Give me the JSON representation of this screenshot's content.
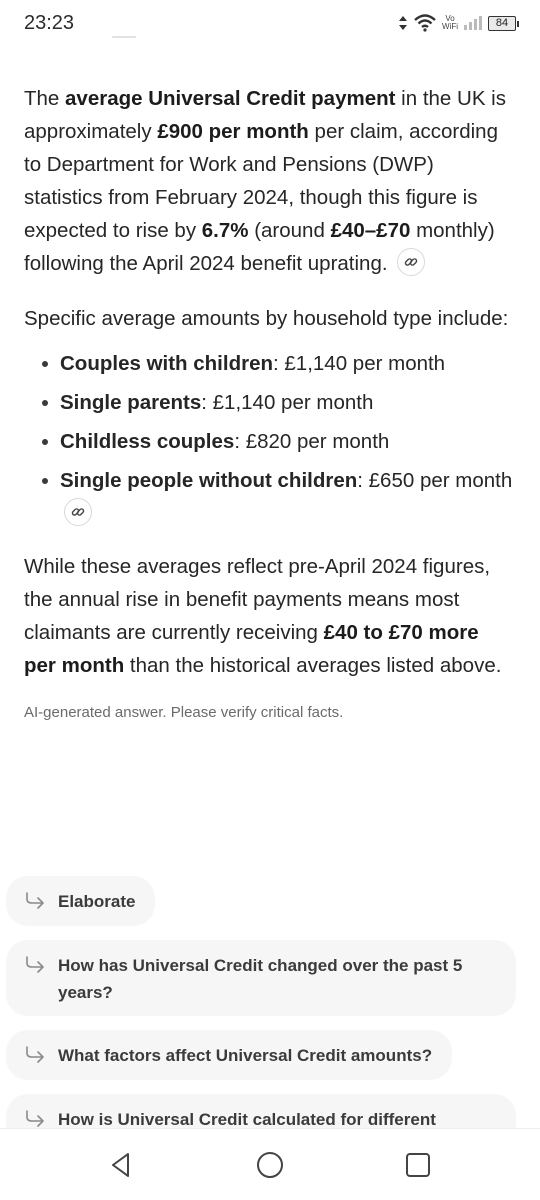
{
  "status": {
    "time": "23:23",
    "volte_top": "Vo",
    "volte_bottom": "WiFi",
    "battery": "84"
  },
  "answer": {
    "p1": {
      "t1": "The ",
      "b1": "average Universal Credit payment",
      "t2": " in the UK is approximately ",
      "b2": "£900 per month",
      "t3": " per claim, according to Department for Work and Pensions (DWP) statistics from February 2024, though this figure is expected to rise by ",
      "b3": "6.7%",
      "t4": " (around ",
      "b4": "£40–£70",
      "t5": " monthly) following the April 2024 benefit uprating."
    },
    "p2": "Specific average amounts by household type include:",
    "items": [
      {
        "label": "Couples with children",
        "value": ": £1,140 per month"
      },
      {
        "label": "Single parents",
        "value": ": £1,140 per month"
      },
      {
        "label": "Childless couples",
        "value": ": £820 per month"
      },
      {
        "label": "Single people without children",
        "value": ": £650 per month"
      }
    ],
    "p3": {
      "t1": "While these averages reflect pre-April 2024 figures, the annual rise in benefit payments means most claimants are currently receiving ",
      "b1": "£40 to £70 more per month",
      "t2": " than the historical averages listed above."
    },
    "disclaimer": "AI-generated answer. Please verify critical facts."
  },
  "followups": [
    "Elaborate",
    "How has Universal Credit changed over the past 5 years?",
    "What factors affect Universal Credit amounts?",
    "How is Universal Credit calculated for different"
  ],
  "icons": {
    "citation": "link-icon",
    "followup": "reply-arrow-icon",
    "nav": [
      "back-triangle-icon",
      "home-circle-icon",
      "recents-square-icon"
    ]
  }
}
